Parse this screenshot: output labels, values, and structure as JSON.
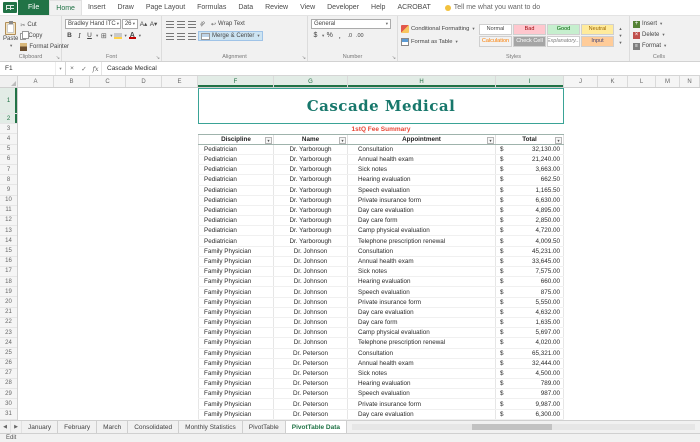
{
  "colors": {
    "excel_green": "#217346",
    "title_teal": "#17776b",
    "subtitle_red": "#e84635",
    "selection_green": "#217346"
  },
  "ribbon_tabs": [
    {
      "label": "File"
    },
    {
      "label": "Home"
    },
    {
      "label": "Insert"
    },
    {
      "label": "Draw"
    },
    {
      "label": "Page Layout"
    },
    {
      "label": "Formulas"
    },
    {
      "label": "Data"
    },
    {
      "label": "Review"
    },
    {
      "label": "View"
    },
    {
      "label": "Developer"
    },
    {
      "label": "Help"
    },
    {
      "label": "ACROBAT"
    }
  ],
  "tell_me": "Tell me what you want to do",
  "ribbon": {
    "clipboard": {
      "label": "Clipboard",
      "paste": "Paste",
      "cut": "Cut",
      "copy": "Copy",
      "format_painter": "Format Painter"
    },
    "font": {
      "label": "Font",
      "name": "Bradley Hand ITC",
      "size": "26",
      "bold": "B",
      "italic": "I",
      "underline": "U"
    },
    "alignment": {
      "label": "Alignment",
      "wrap": "Wrap Text",
      "merge": "Merge & Center"
    },
    "number": {
      "label": "Number",
      "format": "General"
    },
    "styles": {
      "label": "Styles",
      "conditional": "Conditional Formatting",
      "format_table": "Format as Table",
      "gallery": [
        {
          "label": "Normal"
        },
        {
          "label": "Bad"
        },
        {
          "label": "Good"
        },
        {
          "label": "Neutral"
        },
        {
          "label": "Calculation"
        },
        {
          "label": "Check Cell"
        },
        {
          "label": "Explanatory..."
        },
        {
          "label": "Input"
        }
      ]
    },
    "cells": {
      "label": "Cells",
      "insert": "Insert",
      "delete": "Delete",
      "format": "Format"
    }
  },
  "formula_bar": {
    "name_box": "F1",
    "value": "Cascade Medical"
  },
  "grid": {
    "col_letters": [
      "A",
      "B",
      "C",
      "D",
      "E",
      "F",
      "G",
      "H",
      "I",
      "J",
      "K",
      "L",
      "M",
      "N"
    ],
    "row_numbers": [
      "1",
      "2",
      "3",
      "4",
      "5",
      "6",
      "7",
      "8",
      "9",
      "10",
      "11",
      "12",
      "13",
      "14",
      "15",
      "16",
      "17",
      "18",
      "19",
      "20",
      "21",
      "22",
      "23",
      "24",
      "25",
      "26",
      "27",
      "28",
      "29",
      "30",
      "31"
    ],
    "title": "Cascade Medical",
    "subtitle": "1stQ Fee Summary",
    "table": {
      "headers": [
        "Discipline",
        "Name",
        "Appointment",
        "Total"
      ],
      "rows": [
        {
          "discipline": "Pediatrician",
          "name": "Dr. Yarborough",
          "appointment": "Consultation",
          "cur": "$",
          "total": "32,130.00"
        },
        {
          "discipline": "Pediatrician",
          "name": "Dr. Yarborough",
          "appointment": "Annual health exam",
          "cur": "$",
          "total": "21,240.00"
        },
        {
          "discipline": "Pediatrician",
          "name": "Dr. Yarborough",
          "appointment": "Sick notes",
          "cur": "$",
          "total": "3,663.00"
        },
        {
          "discipline": "Pediatrician",
          "name": "Dr. Yarborough",
          "appointment": "Hearing evaluation",
          "cur": "$",
          "total": "662.50"
        },
        {
          "discipline": "Pediatrician",
          "name": "Dr. Yarborough",
          "appointment": "Speech evaluation",
          "cur": "$",
          "total": "1,165.50"
        },
        {
          "discipline": "Pediatrician",
          "name": "Dr. Yarborough",
          "appointment": "Private insurance form",
          "cur": "$",
          "total": "6,630.00"
        },
        {
          "discipline": "Pediatrician",
          "name": "Dr. Yarborough",
          "appointment": "Day care evaluation",
          "cur": "$",
          "total": "4,895.00"
        },
        {
          "discipline": "Pediatrician",
          "name": "Dr. Yarborough",
          "appointment": "Day care form",
          "cur": "$",
          "total": "2,850.00"
        },
        {
          "discipline": "Pediatrician",
          "name": "Dr. Yarborough",
          "appointment": "Camp physical evaluation",
          "cur": "$",
          "total": "4,720.00"
        },
        {
          "discipline": "Pediatrician",
          "name": "Dr. Yarborough",
          "appointment": "Telephone prescription renewal",
          "cur": "$",
          "total": "4,009.50"
        },
        {
          "discipline": "Family Physician",
          "name": "Dr. Johnson",
          "appointment": "Consultation",
          "cur": "$",
          "total": "45,231.00"
        },
        {
          "discipline": "Family Physician",
          "name": "Dr. Johnson",
          "appointment": "Annual health exam",
          "cur": "$",
          "total": "33,645.00"
        },
        {
          "discipline": "Family Physician",
          "name": "Dr. Johnson",
          "appointment": "Sick notes",
          "cur": "$",
          "total": "7,575.00"
        },
        {
          "discipline": "Family Physician",
          "name": "Dr. Johnson",
          "appointment": "Hearing evaluation",
          "cur": "$",
          "total": "660.00"
        },
        {
          "discipline": "Family Physician",
          "name": "Dr. Johnson",
          "appointment": "Speech evaluation",
          "cur": "$",
          "total": "875.00"
        },
        {
          "discipline": "Family Physician",
          "name": "Dr. Johnson",
          "appointment": "Private insurance form",
          "cur": "$",
          "total": "5,550.00"
        },
        {
          "discipline": "Family Physician",
          "name": "Dr. Johnson",
          "appointment": "Day care evaluation",
          "cur": "$",
          "total": "4,632.00"
        },
        {
          "discipline": "Family Physician",
          "name": "Dr. Johnson",
          "appointment": "Day care form",
          "cur": "$",
          "total": "1,635.00"
        },
        {
          "discipline": "Family Physician",
          "name": "Dr. Johnson",
          "appointment": "Camp physical evaluation",
          "cur": "$",
          "total": "5,697.00"
        },
        {
          "discipline": "Family Physician",
          "name": "Dr. Johnson",
          "appointment": "Telephone prescription renewal",
          "cur": "$",
          "total": "4,020.00"
        },
        {
          "discipline": "Family Physician",
          "name": "Dr. Peterson",
          "appointment": "Consultation",
          "cur": "$",
          "total": "65,321.00"
        },
        {
          "discipline": "Family Physician",
          "name": "Dr. Peterson",
          "appointment": "Annual health exam",
          "cur": "$",
          "total": "32,444.00"
        },
        {
          "discipline": "Family Physician",
          "name": "Dr. Peterson",
          "appointment": "Sick notes",
          "cur": "$",
          "total": "4,500.00"
        },
        {
          "discipline": "Family Physician",
          "name": "Dr. Peterson",
          "appointment": "Hearing evaluation",
          "cur": "$",
          "total": "789.00"
        },
        {
          "discipline": "Family Physician",
          "name": "Dr. Peterson",
          "appointment": "Speech evaluation",
          "cur": "$",
          "total": "987.00"
        },
        {
          "discipline": "Family Physician",
          "name": "Dr. Peterson",
          "appointment": "Private insurance form",
          "cur": "$",
          "total": "9,987.00"
        },
        {
          "discipline": "Family Physician",
          "name": "Dr. Peterson",
          "appointment": "Day care evaluation",
          "cur": "$",
          "total": "6,300.00"
        }
      ]
    }
  },
  "sheet_tabs": [
    {
      "label": "January"
    },
    {
      "label": "February"
    },
    {
      "label": "March"
    },
    {
      "label": "Consolidated"
    },
    {
      "label": "Monthly Statistics"
    },
    {
      "label": "PivotTable"
    },
    {
      "label": "PivotTable Data",
      "active": true
    }
  ],
  "status": {
    "mode": "Edit"
  }
}
